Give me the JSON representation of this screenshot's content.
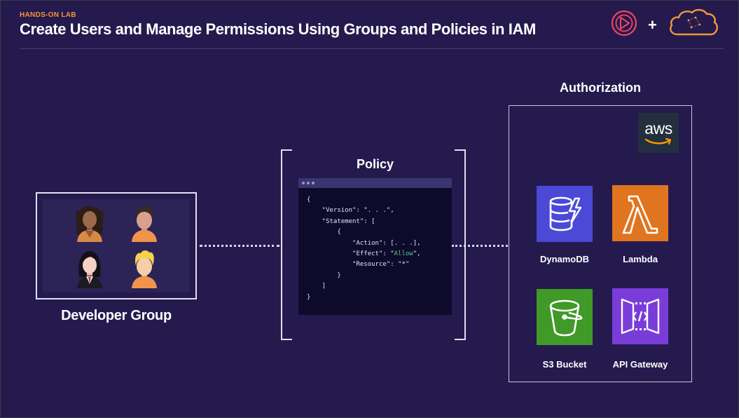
{
  "header": {
    "eyebrow": "HANDS-ON LAB",
    "title": "Create Users and Manage Permissions Using Groups and Policies in IAM",
    "plus": "+"
  },
  "developer_group": {
    "label": "Developer Group",
    "avatars": [
      "woman-dark-curly-hair",
      "man-dark-hair",
      "woman-black-hair-blazer",
      "man-blonde-hair"
    ]
  },
  "policy": {
    "title": "Policy",
    "code": {
      "l1": "{",
      "l2": "    \"Version\": \". . .\",",
      "l3": "    \"Statement\": [",
      "l4": "        {",
      "l5a": "            \"Action\": [. . .],",
      "l6a": "            \"Effect\": \"",
      "l6b": "Allow",
      "l6c": "\",",
      "l7": "            \"Resource\": \"*\"",
      "l8": "        }",
      "l9": "    ]",
      "l10": "}"
    }
  },
  "authorization": {
    "title": "Authorization",
    "aws_logo": "aws",
    "services": [
      {
        "label": "DynamoDB",
        "icon": "dynamodb-icon",
        "color": "#4b49d6"
      },
      {
        "label": "Lambda",
        "icon": "lambda-icon",
        "color": "#e0741f"
      },
      {
        "label": "S3 Bucket",
        "icon": "s3-bucket-icon",
        "color": "#3f9a27"
      },
      {
        "label": "API Gateway",
        "icon": "api-gateway-icon",
        "color": "#7a3cd9"
      }
    ]
  },
  "colors": {
    "background": "#241a4e",
    "accent": "#f5953a",
    "allow": "#4fd18b"
  }
}
